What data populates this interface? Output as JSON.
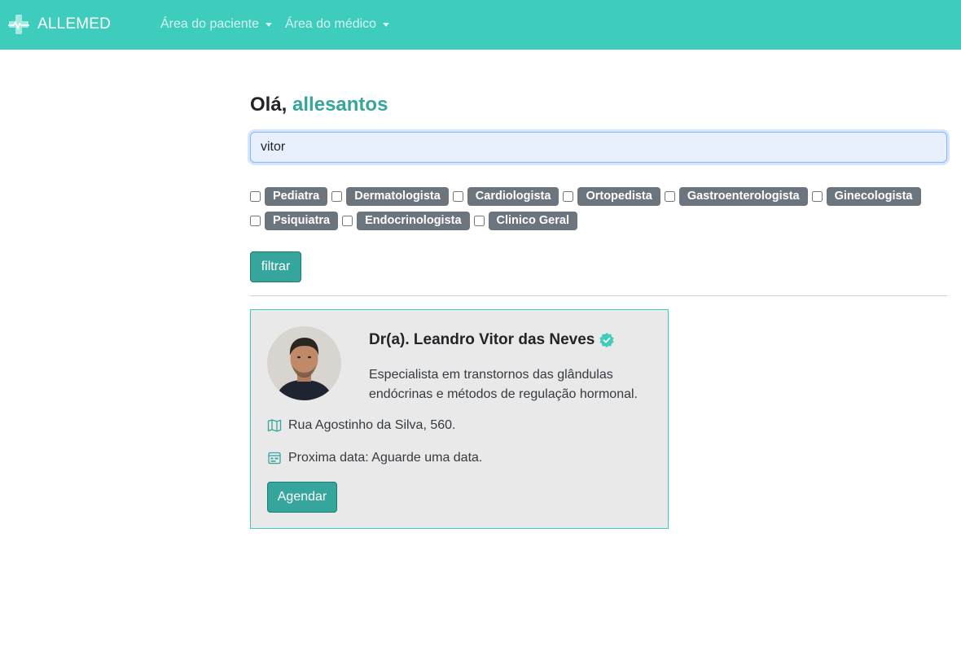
{
  "navbar": {
    "brand": "ALLEMED",
    "items": [
      {
        "label": "Área do paciente"
      },
      {
        "label": "Área do médico"
      }
    ]
  },
  "greeting": {
    "prefix": "Olá,",
    "username": "allesantos"
  },
  "search": {
    "value": "vitor"
  },
  "specialties": [
    "Pediatra",
    "Dermatologista",
    "Cardiologista",
    "Ortopedista",
    "Gastroenterologista",
    "Ginecologista",
    "Psiquiatra",
    "Endocrinologista",
    "Clinico Geral"
  ],
  "filter_button": "filtrar",
  "doctor_card": {
    "name": "Dr(a). Leandro Vitor das Neves",
    "description": "Especialista em transtornos das glândulas endócrinas e métodos de regulação hormonal.",
    "address": "Rua Agostinho da Silva, 560.",
    "next_date": "Proxima data: Aguarde uma data.",
    "schedule_button": "Agendar",
    "icons": {
      "verified": "verified-badge-icon",
      "address": "map-icon",
      "date": "calendar-icon"
    }
  },
  "colors": {
    "navbar": "#3ecdbd",
    "accent": "#36a59c",
    "badge": "#6c757d",
    "card_bg": "#e9e9e9"
  }
}
